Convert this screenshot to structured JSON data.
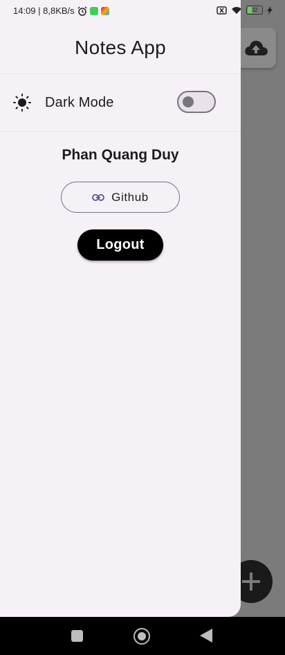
{
  "status_bar": {
    "time_speed": "14:09 | 8,8KB/s",
    "battery": "32"
  },
  "drawer": {
    "title": "Notes App",
    "dark_mode_label": "Dark Mode",
    "dark_mode_enabled": false,
    "user_name": "Phan Quang Duy",
    "github_label": "Github",
    "logout_label": "Logout"
  },
  "icons": {
    "theme": "sun-icon",
    "github": "link-icon",
    "cloud": "cloud-upload-icon",
    "fab": "plus-icon"
  },
  "colors": {
    "drawer_bg": "#f6f1f7",
    "logout_bg": "#000000",
    "scrim": "#7b7b7b"
  }
}
